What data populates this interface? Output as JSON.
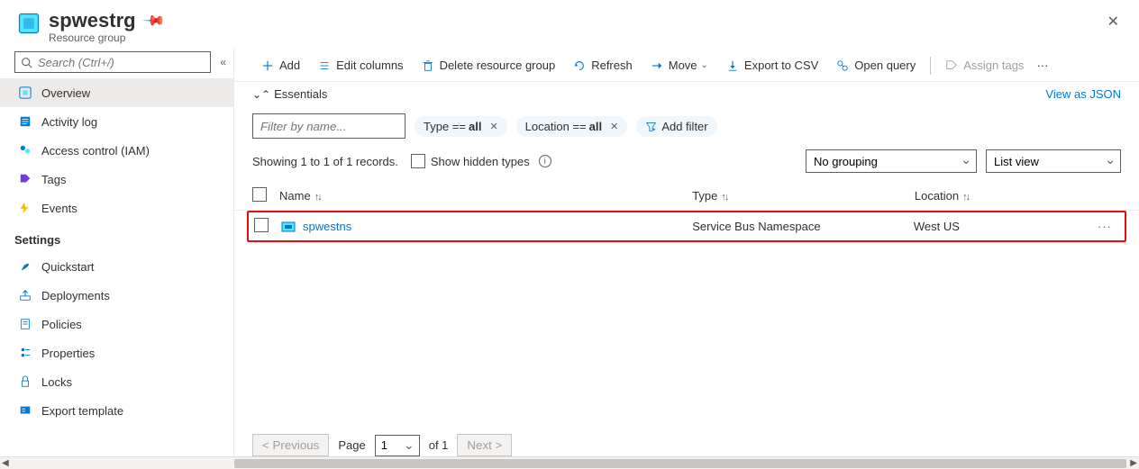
{
  "header": {
    "title": "spwestrg",
    "subtitle": "Resource group"
  },
  "sidebar": {
    "search_placeholder": "Search (Ctrl+/)",
    "items": [
      {
        "label": "Overview",
        "icon": "overview",
        "active": true
      },
      {
        "label": "Activity log",
        "icon": "activity"
      },
      {
        "label": "Access control (IAM)",
        "icon": "iam"
      },
      {
        "label": "Tags",
        "icon": "tags"
      },
      {
        "label": "Events",
        "icon": "events"
      }
    ],
    "settings_heading": "Settings",
    "settings": [
      {
        "label": "Quickstart",
        "icon": "quickstart"
      },
      {
        "label": "Deployments",
        "icon": "deployments"
      },
      {
        "label": "Policies",
        "icon": "policies"
      },
      {
        "label": "Properties",
        "icon": "properties"
      },
      {
        "label": "Locks",
        "icon": "locks"
      },
      {
        "label": "Export template",
        "icon": "export"
      }
    ]
  },
  "toolbar": {
    "add": "Add",
    "edit_columns": "Edit columns",
    "delete_rg": "Delete resource group",
    "refresh": "Refresh",
    "move": "Move",
    "export_csv": "Export to CSV",
    "open_query": "Open query",
    "assign_tags": "Assign tags"
  },
  "essentials": {
    "label": "Essentials",
    "json_link": "View as JSON"
  },
  "filters": {
    "name_placeholder": "Filter by name...",
    "type_key": "Type == ",
    "type_val": "all",
    "loc_key": "Location == ",
    "loc_val": "all",
    "add_filter": "Add filter"
  },
  "options": {
    "record_text": "Showing 1 to 1 of 1 records.",
    "show_hidden": "Show hidden types",
    "grouping": "No grouping",
    "view": "List view"
  },
  "grid": {
    "col_name": "Name",
    "col_type": "Type",
    "col_loc": "Location",
    "rows": [
      {
        "name": "spwestns",
        "type": "Service Bus Namespace",
        "location": "West US"
      }
    ]
  },
  "pager": {
    "prev": "< Previous",
    "page_label": "Page",
    "page_val": "1",
    "of_text": "of 1",
    "next": "Next >"
  }
}
